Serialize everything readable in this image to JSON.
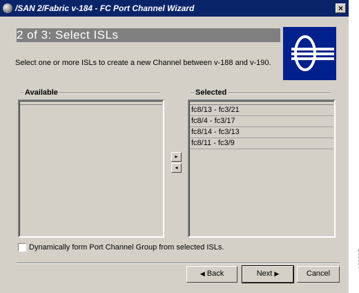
{
  "window": {
    "title": "/SAN 2/Fabric v-184 - FC Port Channel Wizard",
    "close_label": "×"
  },
  "header": {
    "step_title": "2 of 3: Select ISLs"
  },
  "instruction": "Select one or more ISLs to create a new Channel between v-188 and v-190.",
  "available": {
    "label": "Available",
    "items": []
  },
  "selected": {
    "label": "Selected",
    "items": [
      "fc8/13 - fc3/21",
      "fc8/4 - fc3/17",
      "fc8/14 - fc3/13",
      "fc8/11 - fc3/9"
    ]
  },
  "arrows": {
    "add": "▸",
    "remove": "◂"
  },
  "options": {
    "dynamic_label": "Dynamically form Port Channel Group from selected ISLs.",
    "dynamic_checked": false
  },
  "buttons": {
    "back": "Back",
    "next": "Next",
    "cancel": "Cancel"
  },
  "figure_number": "120895",
  "colors": {
    "title_bar": "#0a246a",
    "header_strip": "#808080",
    "logo_bg": "#00208c",
    "dialog_bg": "#d4d0c8"
  }
}
